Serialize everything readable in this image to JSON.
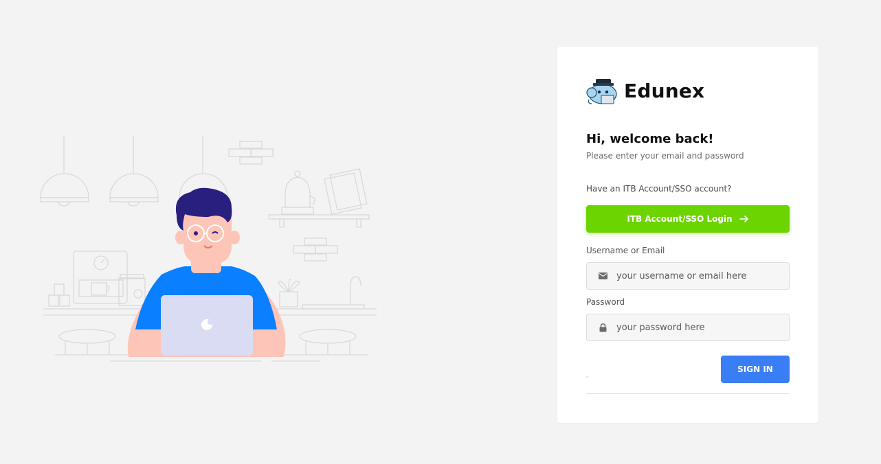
{
  "brand": {
    "name": "Edunex",
    "logo_icon": "edunex-mascot-logo"
  },
  "welcome": {
    "title": "Hi, welcome back!",
    "subtitle": "Please enter your email and password"
  },
  "sso": {
    "question": "Have an ITB Account/SSO account?",
    "button_label": "ITB Account/SSO Login",
    "button_icon": "arrow-right-icon",
    "color": "#6cd400"
  },
  "username": {
    "label": "Username or Email",
    "placeholder": "your username or email here",
    "icon": "envelope-icon"
  },
  "password": {
    "label": "Password",
    "placeholder": "your password here",
    "icon": "lock-icon"
  },
  "signin": {
    "label": "SIGN IN",
    "color": "#3a7ef6"
  },
  "footer_mark": "-",
  "illustration": {
    "icon": "person-at-laptop-illustration"
  }
}
